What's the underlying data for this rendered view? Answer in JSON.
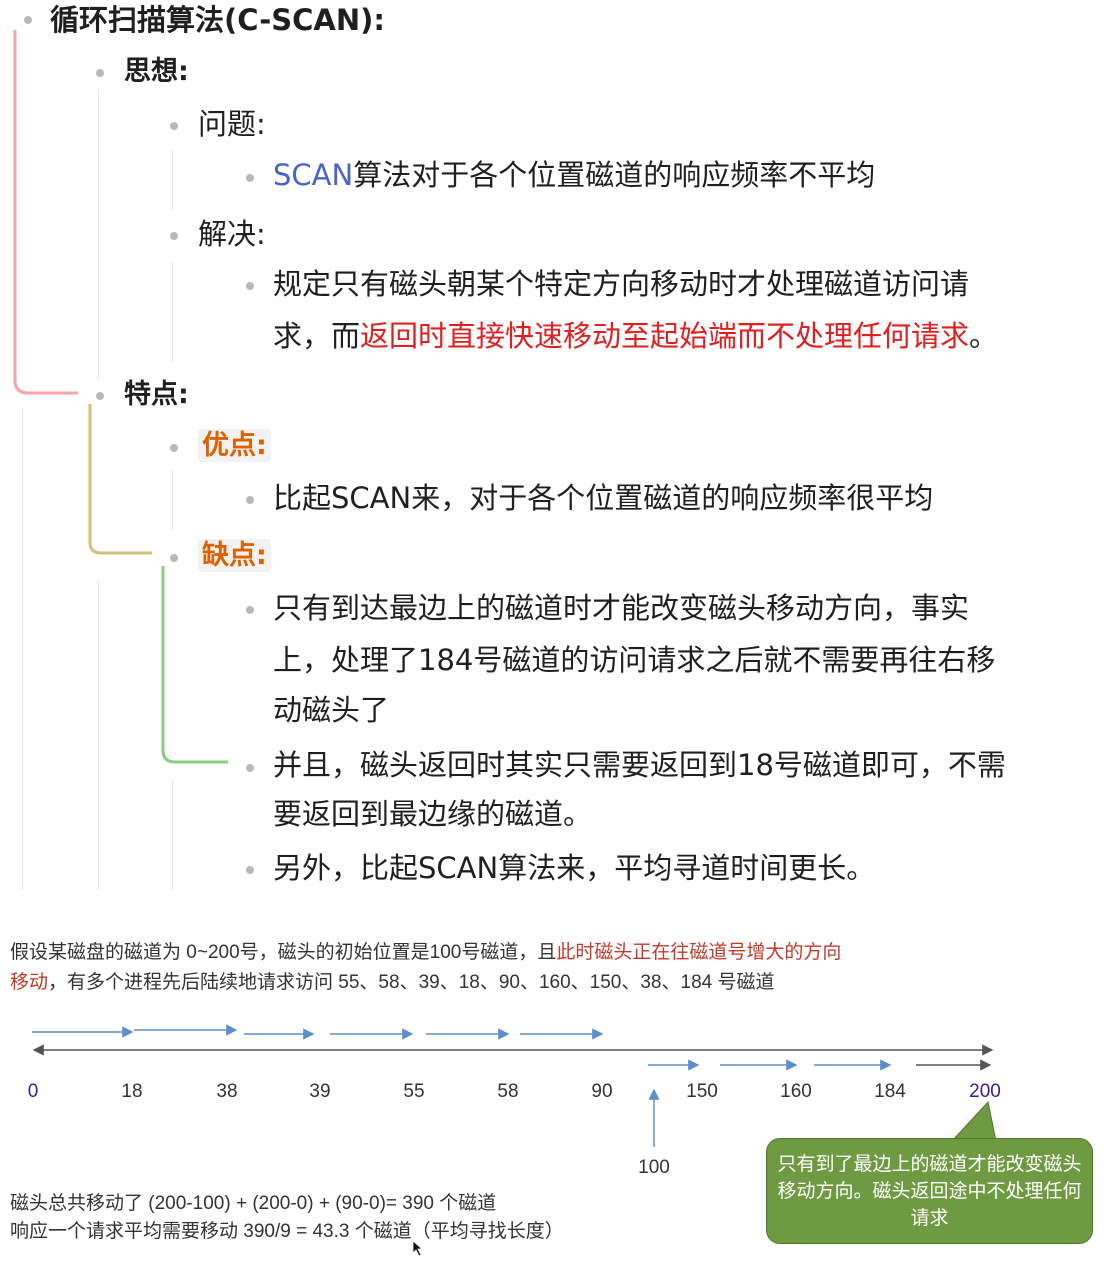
{
  "outline": {
    "title": "循环扫描算法(C-SCAN):",
    "idea": {
      "label": "思想:",
      "problem": {
        "label": "问题:",
        "item_link": "SCAN",
        "item_rest": "算法对于各个位置磁道的响应频率不平均"
      },
      "solution": {
        "label": "解决:",
        "line1": "规定只有磁头朝某个特定方向移动时才处理磁道访问请",
        "line2_start": "求，而",
        "line2_red": "返回时直接快速移动至起始端而不处理任何请求",
        "line2_end": "。"
      }
    },
    "features": {
      "label": "特点:",
      "pros": {
        "label": "优点:",
        "item": "比起SCAN来，对于各个位置磁道的响应频率很平均"
      },
      "cons": {
        "label": "缺点:",
        "item1_line1": "只有到达最边上的磁道时才能改变磁头移动方向，事实",
        "item1_line2": "上，处理了184号磁道的访问请求之后就不需要再往右移",
        "item1_line3": "动磁头了",
        "item2_line1": "并且，磁头返回时其实只需要返回到18号磁道即可，不需",
        "item2_line2": "要返回到最边缘的磁道。",
        "item3": "另外，比起SCAN算法来，平均寻道时间更长。"
      }
    }
  },
  "example": {
    "intro_line1_start": "假设某磁盘的磁道为 0~200号，磁头的初始位置是100号磁道，且",
    "intro_line1_red": "此时磁头正在往磁道号增大的方向",
    "intro_line2_red": "移动",
    "intro_line2_rest": "，有多个进程先后陆续地请求访问 55、58、39、18、90、160、150、38、184 号磁道",
    "tracks": [
      "0",
      "18",
      "38",
      "39",
      "55",
      "58",
      "90",
      "150",
      "160",
      "184",
      "200"
    ],
    "start_position": "100",
    "total_line": "磁头总共移动了 (200-100) + (200-0) + (90-0)= 390 个磁道",
    "average_line": "响应一个请求平均需要移动 390/9 = 43.3 个磁道（平均寻找长度）",
    "callout": "只有到了最边上的磁道才能改变磁头移动方向。磁头返回途中不处理任何请求",
    "colors": {
      "arrow_blue": "#5b8fc7",
      "callout_green": "#6e9a42",
      "endpoint_purple": "#3a1f8c"
    }
  }
}
